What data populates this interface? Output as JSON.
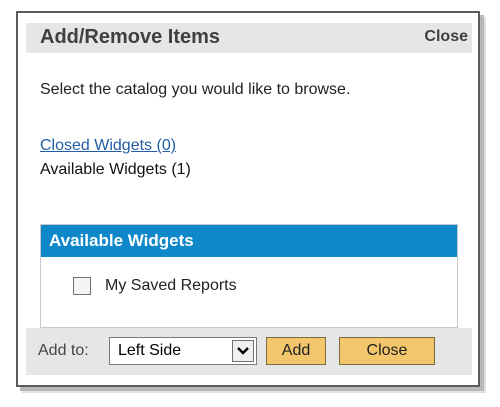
{
  "dialog": {
    "title": "Add/Remove Items",
    "close_link": "Close",
    "instructions": "Select the catalog you would like to browse.",
    "catalogs": {
      "closed": "Closed Widgets (0)",
      "available": "Available Widgets (1)"
    },
    "panel": {
      "header": "Available Widgets",
      "items": [
        {
          "label": "My Saved Reports",
          "checked": false
        }
      ]
    },
    "footer": {
      "add_to_label": "Add to:",
      "select_value": "Left Side",
      "add_button": "Add",
      "close_button": "Close"
    }
  },
  "colors": {
    "header_bg": "#e6e6e6",
    "panel_header_bg": "#0e88c9",
    "button_bg": "#f2c66a",
    "link": "#225ea8"
  },
  "icons": {
    "select_arrow": "chevron-down-icon"
  }
}
